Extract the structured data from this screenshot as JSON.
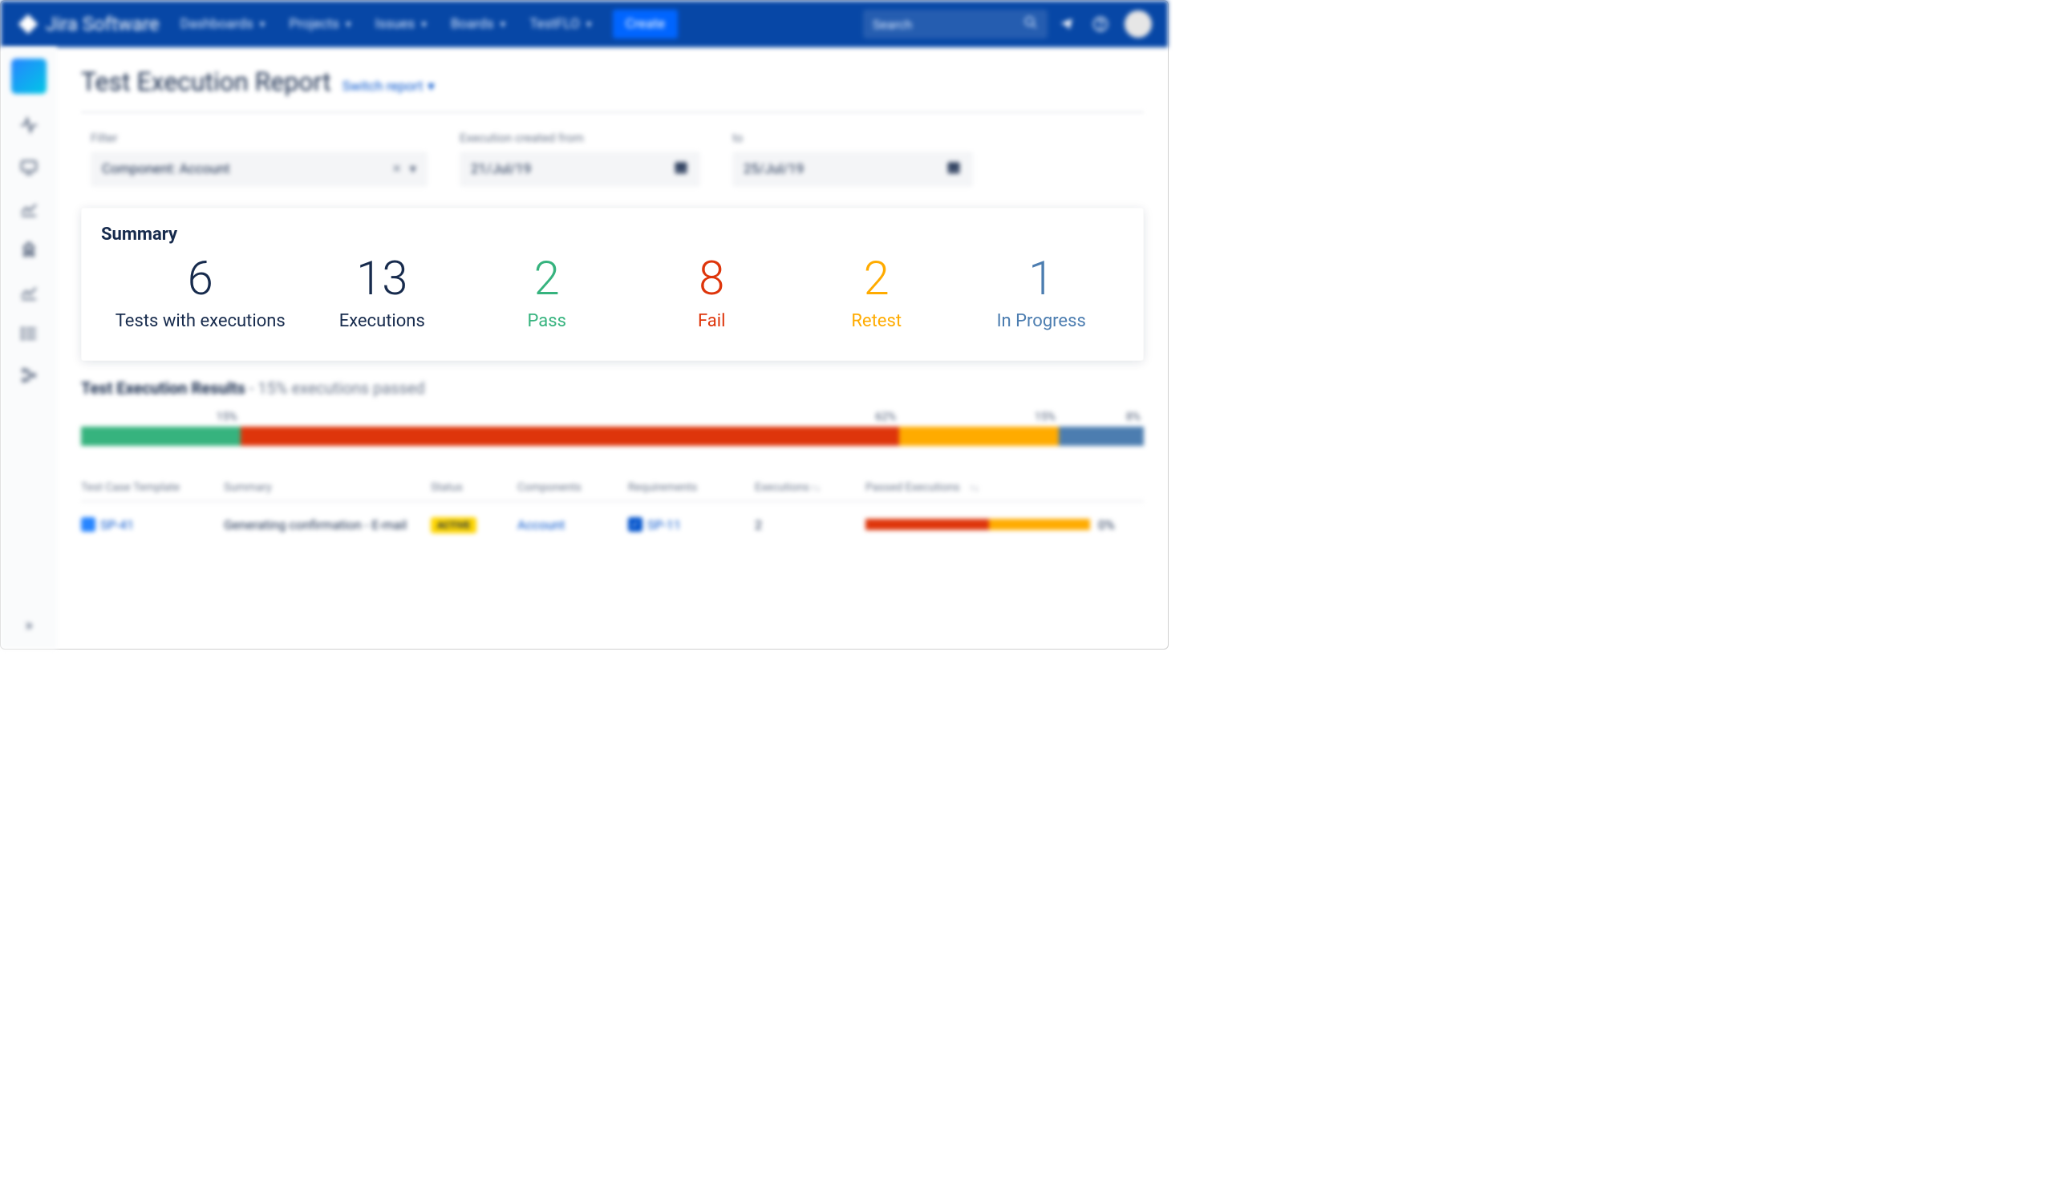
{
  "topnav": {
    "product": "Jira Software",
    "menu": [
      "Dashboards",
      "Projects",
      "Issues",
      "Boards",
      "TestFLO"
    ],
    "create": "Create",
    "search_placeholder": "Search"
  },
  "page": {
    "title": "Test Execution Report",
    "switch_label": "Switch report"
  },
  "filters": {
    "filter_label": "Filter",
    "filter_value": "Component: Account",
    "from_label": "Execution created from",
    "from_value": "21/Jul/19",
    "to_label": "to",
    "to_value": "25/Jul/19"
  },
  "summary": {
    "heading": "Summary",
    "stats": [
      {
        "value": "6",
        "label": "Tests with executions",
        "color": "c-black"
      },
      {
        "value": "13",
        "label": "Executions",
        "color": "c-black"
      },
      {
        "value": "2",
        "label": "Pass",
        "color": "c-green"
      },
      {
        "value": "8",
        "label": "Fail",
        "color": "c-red"
      },
      {
        "value": "2",
        "label": "Retest",
        "color": "c-yellow"
      },
      {
        "value": "1",
        "label": "In Progress",
        "color": "c-blue"
      }
    ]
  },
  "results": {
    "title": "Test Execution Results",
    "subtitle": "- 15% executions passed"
  },
  "chart_data": {
    "type": "bar",
    "title": "Test Execution Results",
    "series": [
      {
        "name": "Pass",
        "value": 15,
        "label": "15%",
        "color": "#36B37E"
      },
      {
        "name": "Fail",
        "value": 62,
        "label": "62%",
        "color": "#DE350B"
      },
      {
        "name": "Retest",
        "value": 15,
        "label": "15%",
        "color": "#FFAB00"
      },
      {
        "name": "In Progress",
        "value": 8,
        "label": "8%",
        "color": "#4C7DB0"
      }
    ]
  },
  "table": {
    "headers": {
      "tct": "Test Case Template",
      "summary": "Summary",
      "status": "Status",
      "components": "Components",
      "requirements": "Requirements",
      "executions": "Executions",
      "passed": "Passed Executions"
    },
    "rows": [
      {
        "tct": "SP-41",
        "summary": "Generating confirmation - E-mail",
        "status": "ACTIVE",
        "components": "Account",
        "requirements": "SP-11",
        "executions": "2",
        "passed_pct": "0%",
        "bar": [
          {
            "color": "seg-red",
            "pct": 55
          },
          {
            "color": "seg-yellow",
            "pct": 45
          }
        ]
      }
    ]
  }
}
